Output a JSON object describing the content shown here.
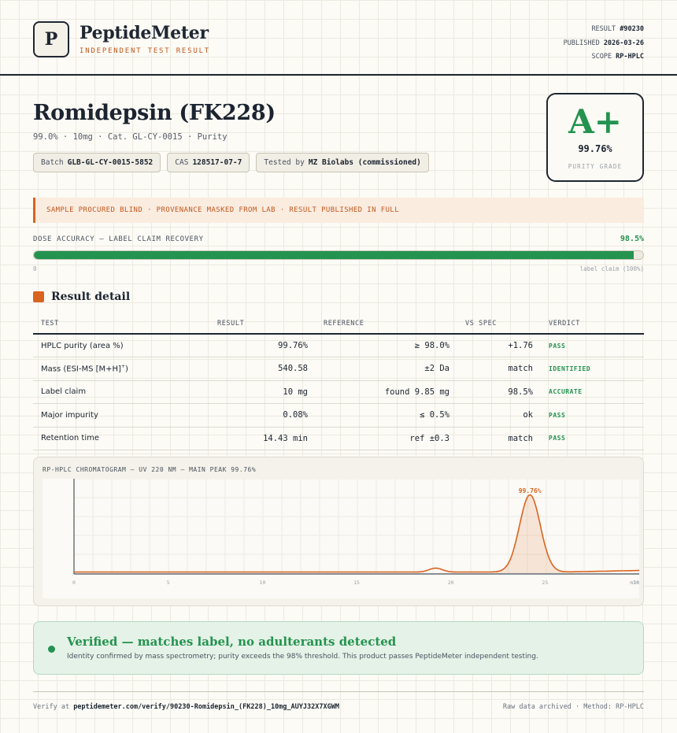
{
  "header": {
    "logo_letter": "P",
    "brand": "PeptideMeter",
    "tagline": "INDEPENDENT TEST RESULT",
    "meta": [
      {
        "label": "RESULT",
        "value": "#90230"
      },
      {
        "label": "PUBLISHED",
        "value": "2026-03-26"
      },
      {
        "label": "SCOPE",
        "value": "RP-HPLC"
      }
    ]
  },
  "product": {
    "title": "Romidepsin (FK228)",
    "subtitle": "99.0% · 10mg · Cat. GL-CY-0015 · Purity",
    "chips": [
      {
        "label": "Batch",
        "value": "GLB-GL-CY-0015-5852"
      },
      {
        "label": "CAS",
        "value": "128517-07-7"
      },
      {
        "label": "Tested by",
        "value": "MZ Biolabs (commissioned)"
      }
    ]
  },
  "grade": {
    "letter": "A+",
    "value": "99.76%",
    "label": "PURITY GRADE",
    "color": "#23934f"
  },
  "banner": {
    "text": "SAMPLE PROCURED BLIND · PROVENANCE MASKED FROM LAB · RESULT PUBLISHED IN FULL"
  },
  "dose": {
    "label": "DOSE ACCURACY — LABEL CLAIM RECOVERY",
    "value": "98.5%",
    "fraction": 0.985,
    "min_label": "0",
    "max_label": "label claim (100%)"
  },
  "results": {
    "title": "Result detail",
    "columns": [
      "TEST",
      "RESULT",
      "REFERENCE",
      "VS SPEC",
      "VERDICT"
    ],
    "rows": [
      {
        "test": "HPLC purity (area %)",
        "result": "99.76%",
        "reference": "≥ 98.0%",
        "vs_spec": "+1.76",
        "verdict": "PASS"
      },
      {
        "test": "Mass (ESI-MS [M+H]",
        "test_sup": "+",
        "test_suffix": ")",
        "result": "540.58",
        "reference": "±2 Da",
        "vs_spec": "match",
        "verdict": "IDENTIFIED"
      },
      {
        "test": "Label claim",
        "result": "10 mg",
        "reference": "found 9.85 mg",
        "vs_spec": "98.5%",
        "verdict": "ACCURATE"
      },
      {
        "test": "Major impurity",
        "result": "0.08%",
        "reference": "≤ 0.5%",
        "vs_spec": "ok",
        "verdict": "PASS"
      },
      {
        "test": "Retention time",
        "result": "14.43 min",
        "reference": "ref ±0.3",
        "vs_spec": "match",
        "verdict": "PASS"
      }
    ]
  },
  "chart_data": {
    "type": "line",
    "title": "RP-HPLC CHROMATOGRAM — UV 220 NM — MAIN PEAK 99.76%",
    "xlabel": "",
    "ylabel": "",
    "xlim": [
      0,
      30
    ],
    "ylim": [
      0,
      100
    ],
    "x_ticks": [
      "0",
      "5",
      "10",
      "15",
      "20",
      "25",
      "30"
    ],
    "x_unit": "min",
    "grid": true,
    "color": "#d9641f",
    "peaks": [
      {
        "x": 19.2,
        "height": 5,
        "width": 0.35
      },
      {
        "x": 24.2,
        "height": 100,
        "width": 0.55,
        "label": "99.76%"
      }
    ],
    "baseline": 1.5,
    "tail_end": 3.5
  },
  "verified": {
    "title": "Verified — matches label, no adulterants detected",
    "text": "Identity confirmed by mass spectrometry; purity exceeds the 98% threshold. This product passes PeptideMeter independent testing."
  },
  "footer": {
    "verify_label": "Verify at",
    "verify_url": "peptidemeter.com/verify/90230-Romidepsin_(FK228)_10mg_AUYJ32X7XGWM",
    "right": "Raw data archived · Method: RP-HPLC"
  }
}
